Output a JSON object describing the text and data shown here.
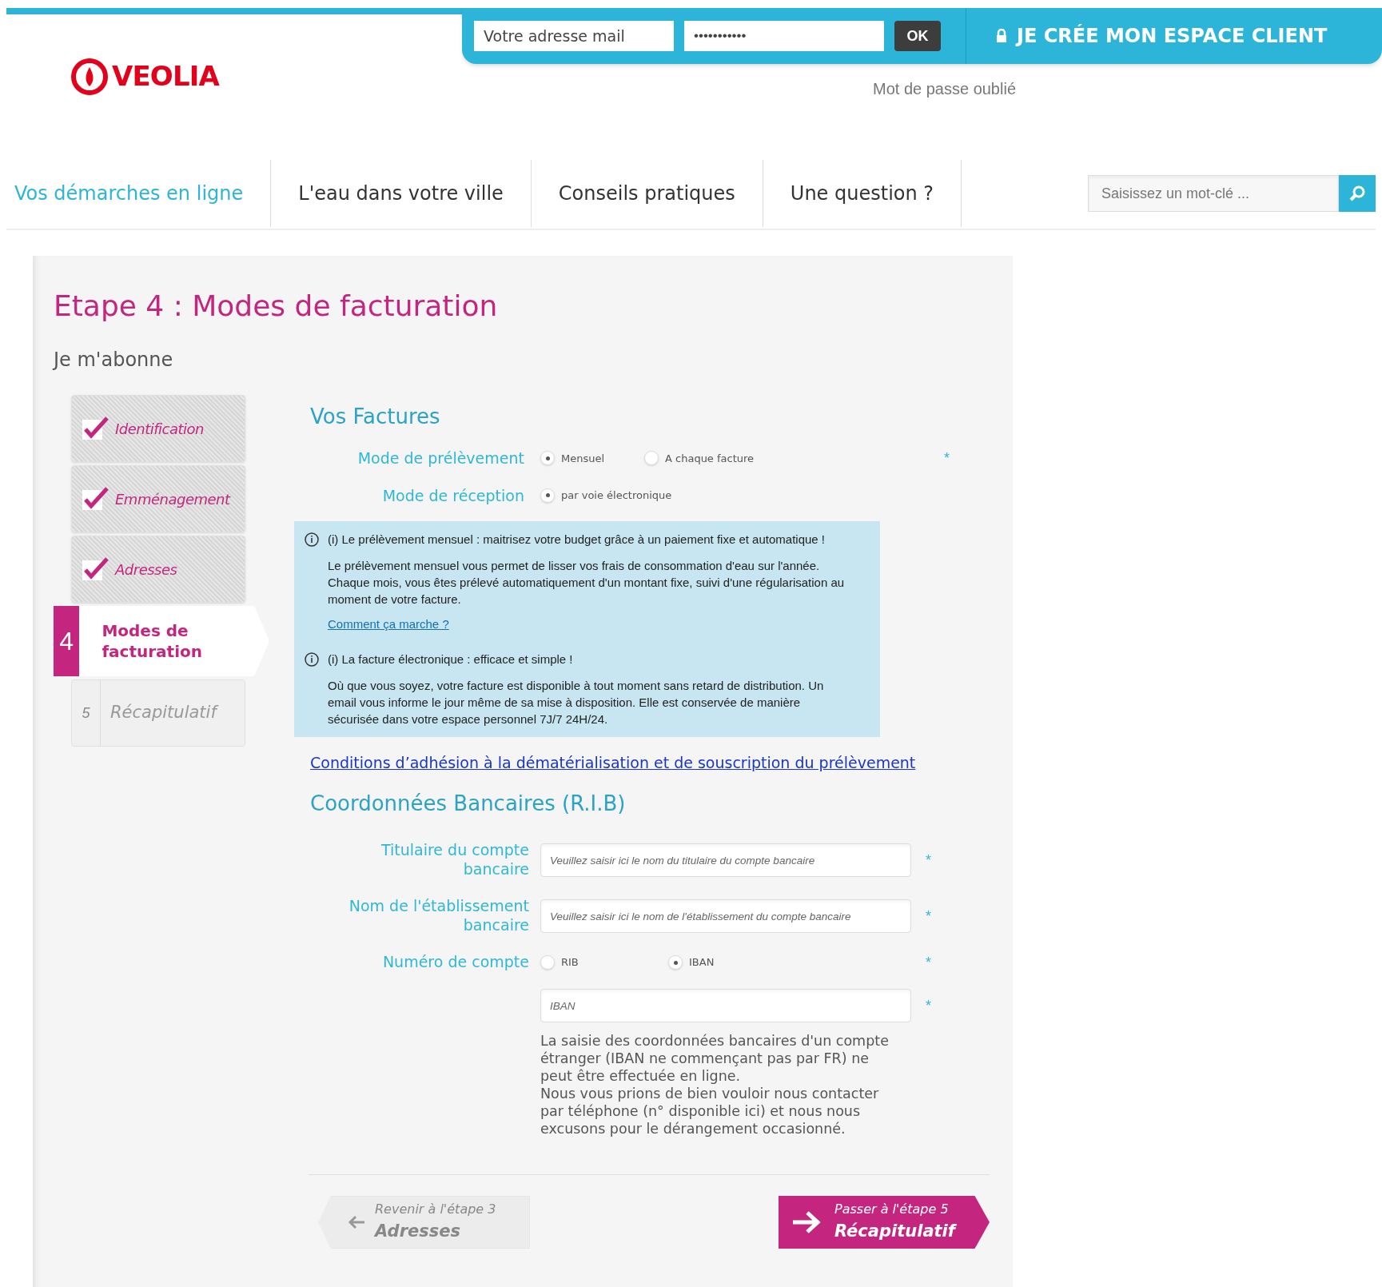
{
  "header": {
    "logo": "VEOLIA",
    "login": {
      "email_placeholder": "Votre adresse mail",
      "password_value": "•••••••••••",
      "ok_button": "OK",
      "create_account": "JE CRÉE MON ESPACE CLIENT"
    },
    "forgot_password": "Mot de passe oublié"
  },
  "nav": {
    "items": [
      {
        "label": "Vos démarches en ligne",
        "selected": true
      },
      {
        "label": "L'eau dans votre ville",
        "selected": false
      },
      {
        "label": "Conseils pratiques",
        "selected": false
      },
      {
        "label": "Une question ?",
        "selected": false
      }
    ],
    "search_placeholder": "Saisissez un mot-clé ..."
  },
  "page": {
    "title": "Etape 4 : Modes de facturation",
    "subtitle": "Je m'abonne",
    "steps": [
      {
        "kind": "done",
        "label": "Identification"
      },
      {
        "kind": "done",
        "label": "Emménagement"
      },
      {
        "kind": "done",
        "label": "Adresses"
      },
      {
        "kind": "current",
        "number": "4",
        "label": "Modes de facturation"
      },
      {
        "kind": "todo",
        "number": "5",
        "label": "Récapitulatif"
      }
    ],
    "invoices": {
      "heading": "Vos Factures",
      "rows": [
        {
          "label": "Mode de prélèvement",
          "required_mark": "*",
          "options": [
            {
              "label": "Mensuel",
              "selected": true
            },
            {
              "label": "A chaque facture",
              "selected": false
            }
          ]
        },
        {
          "label": "Mode de réception",
          "options": [
            {
              "label": "par voie électronique",
              "selected": true
            }
          ]
        }
      ],
      "info": [
        {
          "title": "(i) Le prélèvement mensuel : maitrisez votre budget grâce à un paiement fixe et automatique !",
          "body": "Le prélèvement mensuel vous permet de lisser vos frais de consommation d'eau sur l'année. Chaque mois, vous êtes prélevé automatiquement d'un montant fixe, suivi d'une régularisation au moment de votre facture.",
          "link": "Comment ça marche ?"
        },
        {
          "title": "(i) La facture électronique : efficace et simple !",
          "body": "Où que vous soyez, votre facture est disponible à tout moment sans retard de distribution. Un email vous informe le jour même de sa mise à disposition. Elle est conservée de manière sécurisée dans votre espace personnel 7J/7 24H/24."
        }
      ],
      "conditions_link": "Conditions d’adhésion à la dématérialisation et de souscription du prélèvement"
    },
    "bank": {
      "heading": "Coordonnées Bancaires (R.I.B)",
      "rows": [
        {
          "kind": "field",
          "label": "Titulaire du compte bancaire",
          "placeholder": "Veuillez saisir ici le nom du titulaire du compte bancaire",
          "required_mark": "*"
        },
        {
          "kind": "field",
          "label": "Nom de l'établissement bancaire",
          "placeholder": "Veuillez saisir ici le nom de l'établissement du compte bancaire",
          "required_mark": "*"
        },
        {
          "kind": "radio",
          "label": "Numéro de compte",
          "required_mark": "*",
          "options": [
            {
              "label": "RIB",
              "selected": false
            },
            {
              "label": "IBAN",
              "selected": true
            }
          ]
        },
        {
          "kind": "field",
          "placeholder": "IBAN",
          "required_mark": "*"
        }
      ],
      "note": [
        "La saisie des coordonnées bancaires d'un compte étranger (IBAN ne commençant pas par FR) ne peut être effectuée en ligne.",
        "Nous vous prions de bien vouloir nous contacter par téléphone (n° disponible ici) et nous nous excusons pour le dérangement occasionné."
      ]
    },
    "back_button": {
      "caption": "Revenir à l'étape 3",
      "label": "Adresses"
    },
    "next_button": {
      "caption": "Passer à l'étape 5",
      "label": "Récapitulatif"
    }
  }
}
